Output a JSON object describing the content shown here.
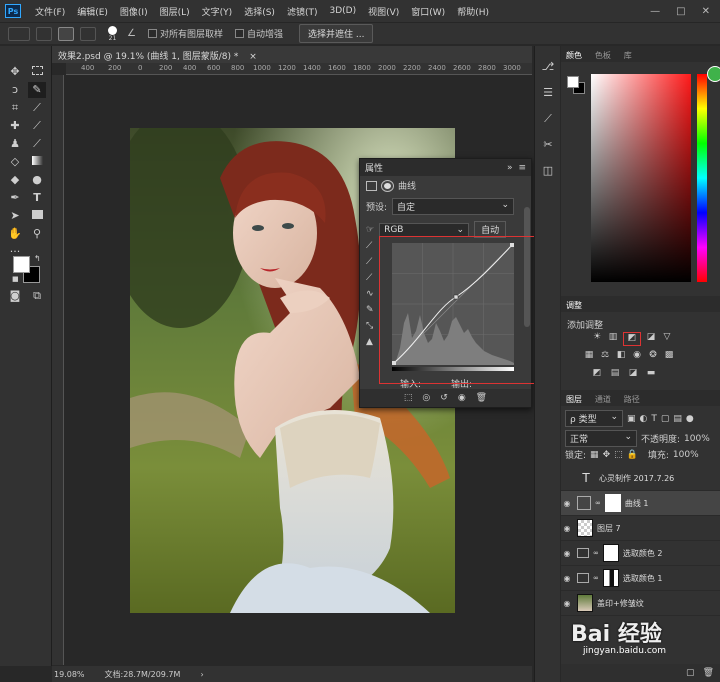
{
  "menubar": {
    "logo": "Ps",
    "items": [
      "文件(F)",
      "编辑(E)",
      "图像(I)",
      "图层(L)",
      "文字(Y)",
      "选择(S)",
      "滤镜(T)",
      "3D(D)",
      "视图(V)",
      "窗口(W)",
      "帮助(H)"
    ],
    "controls": [
      "—",
      "□",
      "✕"
    ]
  },
  "options": {
    "brush_size": "21",
    "sample_all": "对所有图层取样",
    "auto_enhance": "自动增强",
    "select_mask": "选择并遮住 ..."
  },
  "document": {
    "tab": "效果2.psd @ 19.1% (曲线 1, 图层蒙版/8) *",
    "close": "×",
    "ruler_marks": [
      "400",
      "200",
      "0",
      "200",
      "400",
      "600",
      "800",
      "1000",
      "1200",
      "1400",
      "1600",
      "1800",
      "2000",
      "2200",
      "2400",
      "2600",
      "2800",
      "3000"
    ],
    "zoom": "19.08%",
    "doc_size": "文档:28.7M/209.7M"
  },
  "properties": {
    "title": "属性",
    "collapse": "»",
    "menu": "≡",
    "subtitle": "曲线",
    "preset_label": "预设:",
    "preset_value": "自定",
    "channel_value": "RGB",
    "auto_label": "自动",
    "input_label": "输入:",
    "output_label": "输出:"
  },
  "swatches_panel": {
    "tabs": [
      "颜色",
      "色板",
      "库"
    ]
  },
  "adjustments": {
    "tab": "调整",
    "add_label": "添加调整"
  },
  "layers_panel": {
    "tabs": [
      "图层",
      "通道",
      "路径"
    ],
    "kind_filter": "ρ 类型",
    "blend_mode": "正常",
    "opacity_label": "不透明度:",
    "opacity_value": "100%",
    "lock_label": "锁定:",
    "fill_label": "填充:",
    "fill_value": "100%",
    "layers": [
      {
        "name": "心灵制作 2017.7.26",
        "type": "text"
      },
      {
        "name": "曲线 1",
        "type": "curves",
        "selected": true
      },
      {
        "name": "图层 7",
        "type": "pixel"
      },
      {
        "name": "选取颜色 2",
        "type": "adjust"
      },
      {
        "name": "选取颜色 1",
        "type": "adjust"
      },
      {
        "name": "盖印+修皱纹",
        "type": "photo"
      }
    ]
  },
  "watermark": {
    "brand": "Bai 经验",
    "url": "jingyan.baidu.com"
  },
  "colors": {
    "accent_red": "#d33333",
    "panel_bg": "#323232"
  }
}
